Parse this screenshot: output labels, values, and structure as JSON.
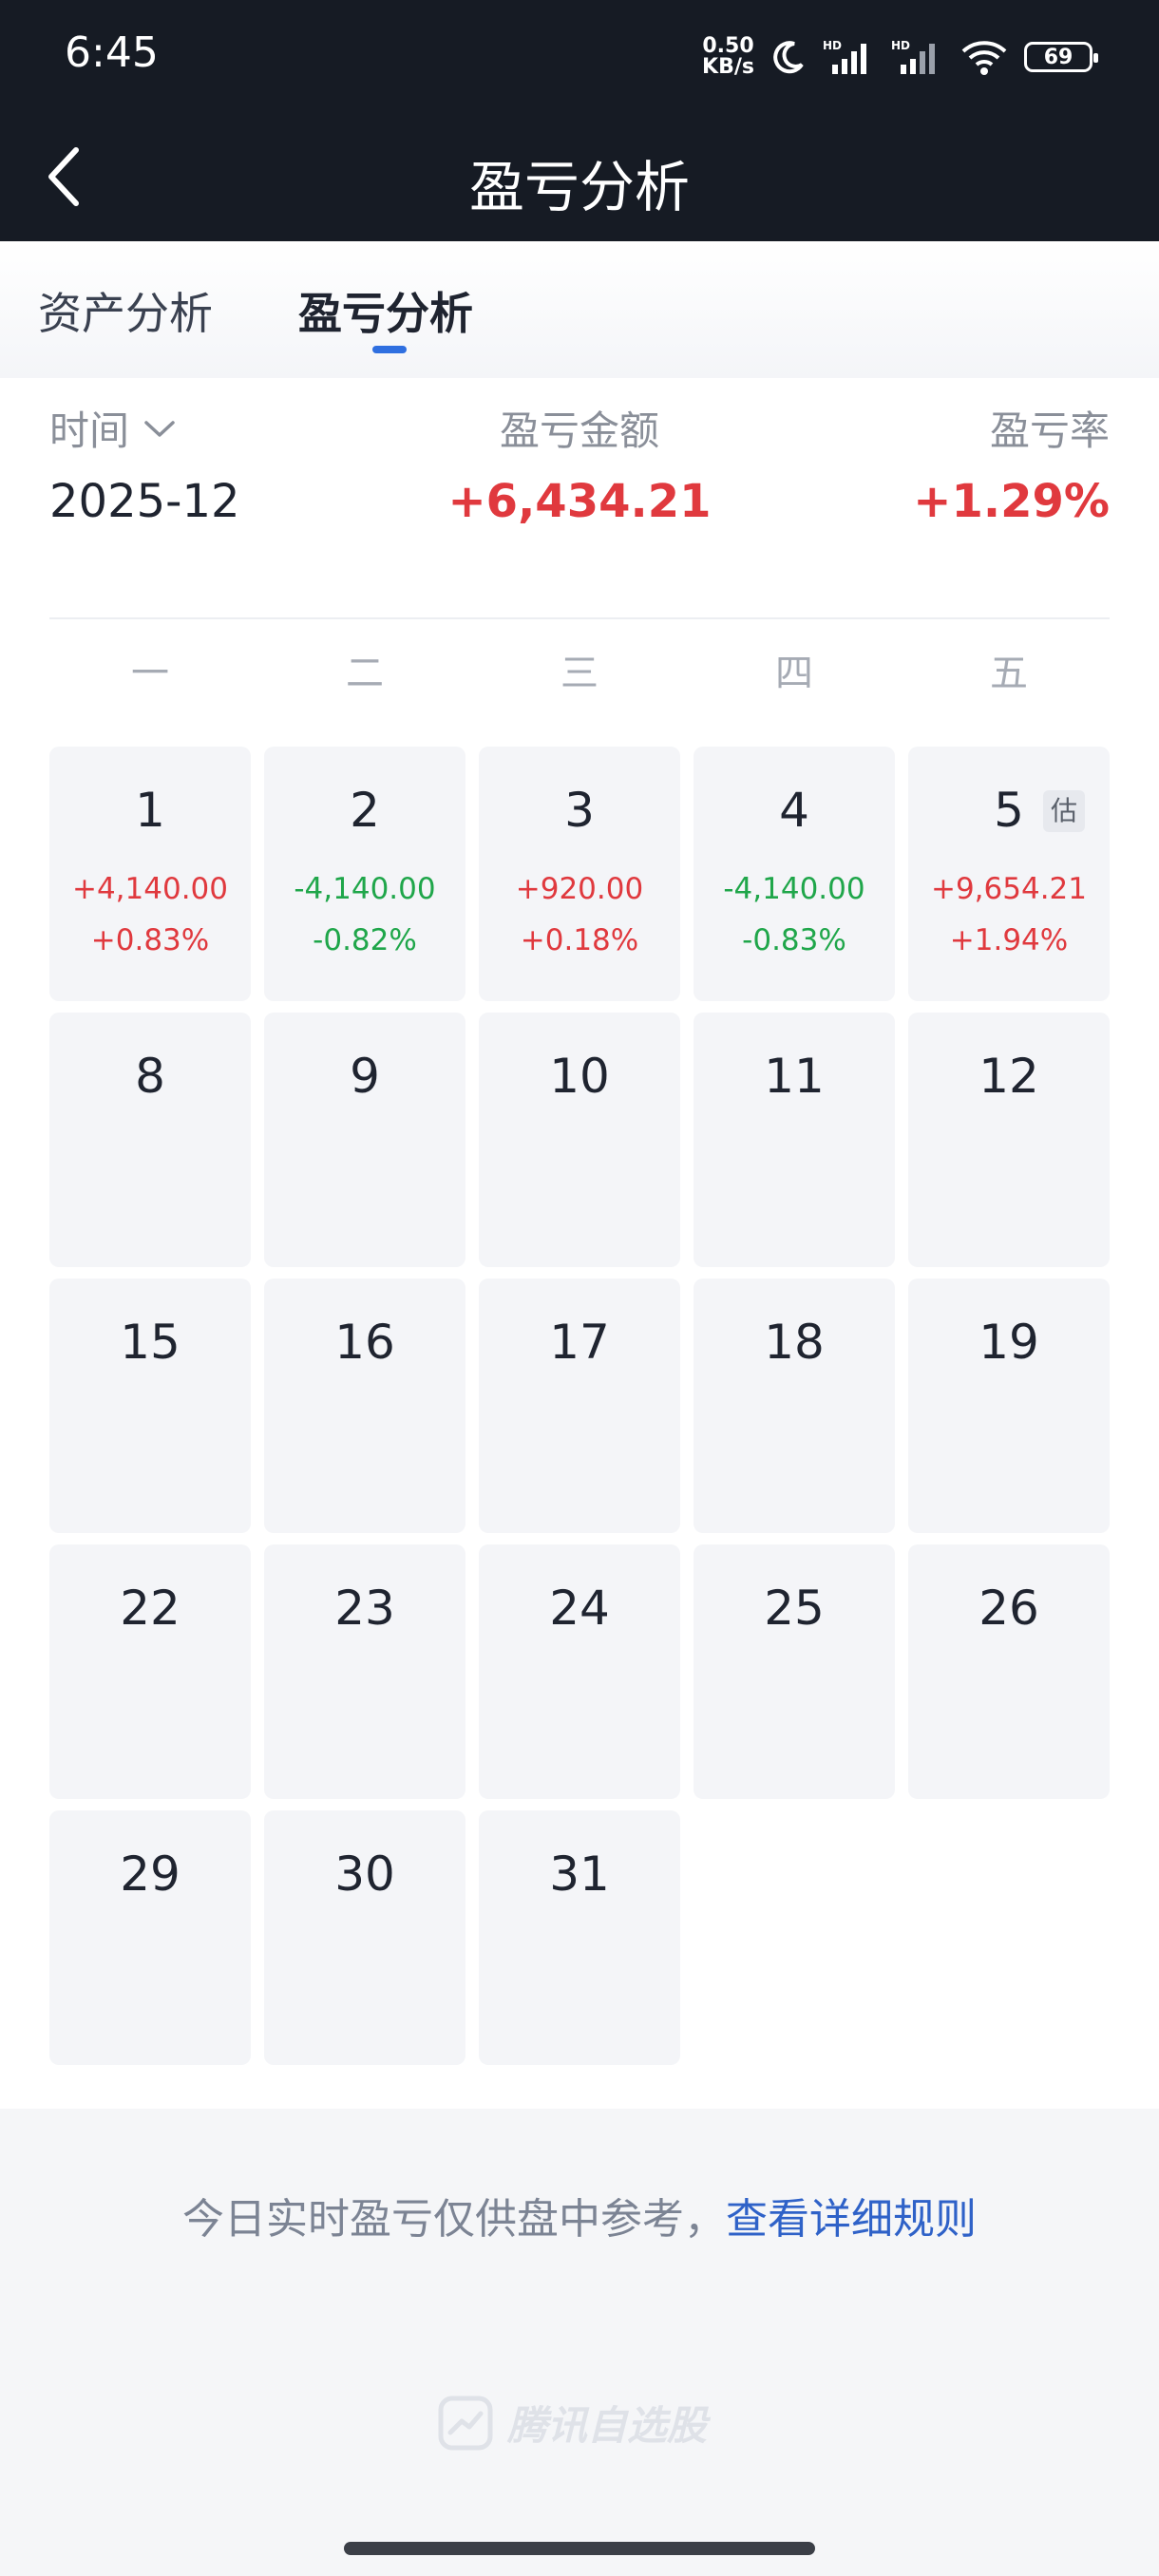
{
  "status": {
    "time": "6:45",
    "net_speed_value": "0.50",
    "net_speed_unit": "KB/s",
    "battery": "69",
    "icons": [
      "moon-icon",
      "signal-hd-icon",
      "signal-hd-icon-2",
      "wifi-icon",
      "battery-icon"
    ]
  },
  "nav": {
    "title": "盈亏分析",
    "back_icon": "chevron-left-icon"
  },
  "tabs": [
    {
      "label": "资产分析",
      "active": false
    },
    {
      "label": "盈亏分析",
      "active": true
    }
  ],
  "summary": {
    "time_label": "时间",
    "time_value": "2025-12",
    "amount_label": "盈亏金额",
    "amount_value": "+6,434.21",
    "rate_label": "盈亏率",
    "rate_value": "+1.29%",
    "colors": {
      "positive": "#e0393e",
      "negative": "#1fa64a"
    }
  },
  "weekdays": [
    "一",
    "二",
    "三",
    "四",
    "五"
  ],
  "calendar": {
    "days": [
      {
        "day": "1",
        "amount": "+4,140.00",
        "rate": "+0.83%",
        "trend": "pos"
      },
      {
        "day": "2",
        "amount": "-4,140.00",
        "rate": "-0.82%",
        "trend": "neg"
      },
      {
        "day": "3",
        "amount": "+920.00",
        "rate": "+0.18%",
        "trend": "pos"
      },
      {
        "day": "4",
        "amount": "-4,140.00",
        "rate": "-0.83%",
        "trend": "neg"
      },
      {
        "day": "5",
        "amount": "+9,654.21",
        "rate": "+1.94%",
        "trend": "pos",
        "badge": "估"
      },
      {
        "day": "8"
      },
      {
        "day": "9"
      },
      {
        "day": "10"
      },
      {
        "day": "11"
      },
      {
        "day": "12"
      },
      {
        "day": "15"
      },
      {
        "day": "16"
      },
      {
        "day": "17"
      },
      {
        "day": "18"
      },
      {
        "day": "19"
      },
      {
        "day": "22"
      },
      {
        "day": "23"
      },
      {
        "day": "24"
      },
      {
        "day": "25"
      },
      {
        "day": "26"
      },
      {
        "day": "29"
      },
      {
        "day": "30"
      },
      {
        "day": "31"
      }
    ]
  },
  "footer": {
    "note": "今日实时盈亏仅供盘中参考，",
    "link": "查看详细规则",
    "watermark": "腾讯自选股"
  }
}
